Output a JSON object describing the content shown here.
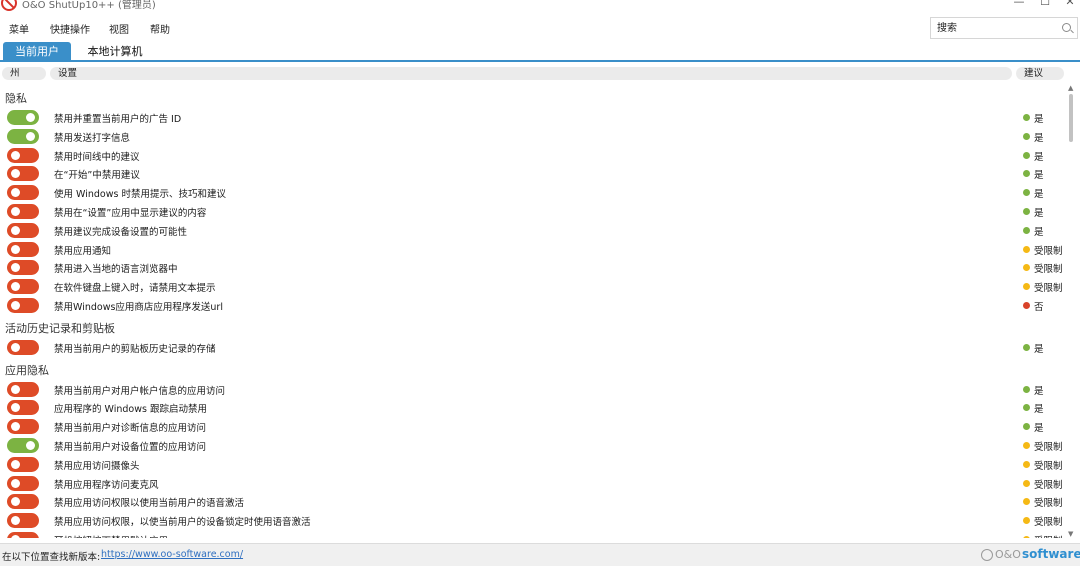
{
  "window": {
    "title": "O&O ShutUp10++ (管理员)",
    "minimize": "—",
    "maximize": "☐",
    "close": "✕"
  },
  "menu": [
    "菜单",
    "快捷操作",
    "视图",
    "帮助"
  ],
  "search": {
    "placeholder": "搜索"
  },
  "tabs": [
    {
      "label": "当前用户",
      "active": true
    },
    {
      "label": "本地计算机",
      "active": false
    }
  ],
  "columns": {
    "state": "州",
    "setting": "设置",
    "recommendation": "建议"
  },
  "colors": {
    "toggle_on": "#7cb342",
    "toggle_off": "#de4b27",
    "rec_yes": "#7cb342",
    "rec_limited": "#f5b915",
    "rec_no": "#d9432a",
    "accent": "#3a8fc9"
  },
  "sections": [
    {
      "title": "隐私",
      "items": [
        {
          "label": "禁用并重置当前用户的广告 ID",
          "on": true,
          "rec": "是",
          "level": "yes"
        },
        {
          "label": "禁用发送打字信息",
          "on": true,
          "rec": "是",
          "level": "yes"
        },
        {
          "label": "禁用时间线中的建议",
          "on": false,
          "rec": "是",
          "level": "yes"
        },
        {
          "label": "在“开始”中禁用建议",
          "on": false,
          "rec": "是",
          "level": "yes"
        },
        {
          "label": "使用 Windows 时禁用提示、技巧和建议",
          "on": false,
          "rec": "是",
          "level": "yes"
        },
        {
          "label": "禁用在“设置”应用中显示建议的内容",
          "on": false,
          "rec": "是",
          "level": "yes"
        },
        {
          "label": "禁用建议完成设备设置的可能性",
          "on": false,
          "rec": "是",
          "level": "yes"
        },
        {
          "label": "禁用应用通知",
          "on": false,
          "rec": "受限制",
          "level": "limited"
        },
        {
          "label": "禁用进入当地的语言浏览器中",
          "on": false,
          "rec": "受限制",
          "level": "limited"
        },
        {
          "label": "在软件键盘上键入时，请禁用文本提示",
          "on": false,
          "rec": "受限制",
          "level": "limited"
        },
        {
          "label": "禁用Windows应用商店应用程序发送url",
          "on": false,
          "rec": "否",
          "level": "no"
        }
      ]
    },
    {
      "title": "活动历史记录和剪贴板",
      "items": [
        {
          "label": "禁用当前用户的剪贴板历史记录的存储",
          "on": false,
          "rec": "是",
          "level": "yes"
        }
      ]
    },
    {
      "title": "应用隐私",
      "items": [
        {
          "label": "禁用当前用户对用户帐户信息的应用访问",
          "on": false,
          "rec": "是",
          "level": "yes"
        },
        {
          "label": "应用程序的 Windows 跟踪启动禁用",
          "on": false,
          "rec": "是",
          "level": "yes"
        },
        {
          "label": "禁用当前用户对诊断信息的应用访问",
          "on": false,
          "rec": "是",
          "level": "yes"
        },
        {
          "label": "禁用当前用户对设备位置的应用访问",
          "on": true,
          "rec": "受限制",
          "level": "limited"
        },
        {
          "label": "禁用应用访问摄像头",
          "on": false,
          "rec": "受限制",
          "level": "limited"
        },
        {
          "label": "禁用应用程序访问麦克风",
          "on": false,
          "rec": "受限制",
          "level": "limited"
        },
        {
          "label": "禁用应用访问权限以使用当前用户的语音激活",
          "on": false,
          "rec": "受限制",
          "level": "limited"
        },
        {
          "label": "禁用应用访问权限，以使当前用户的设备锁定时使用语音激活",
          "on": false,
          "rec": "受限制",
          "level": "limited"
        },
        {
          "label": "耳机按钮按下禁用默认应用",
          "on": false,
          "rec": "受限制",
          "level": "limited"
        }
      ]
    }
  ],
  "status": {
    "text": "在以下位置查找新版本:",
    "link": "https://www.oo-software.com/",
    "brand_prefix": "O&O",
    "brand_name": "software"
  }
}
